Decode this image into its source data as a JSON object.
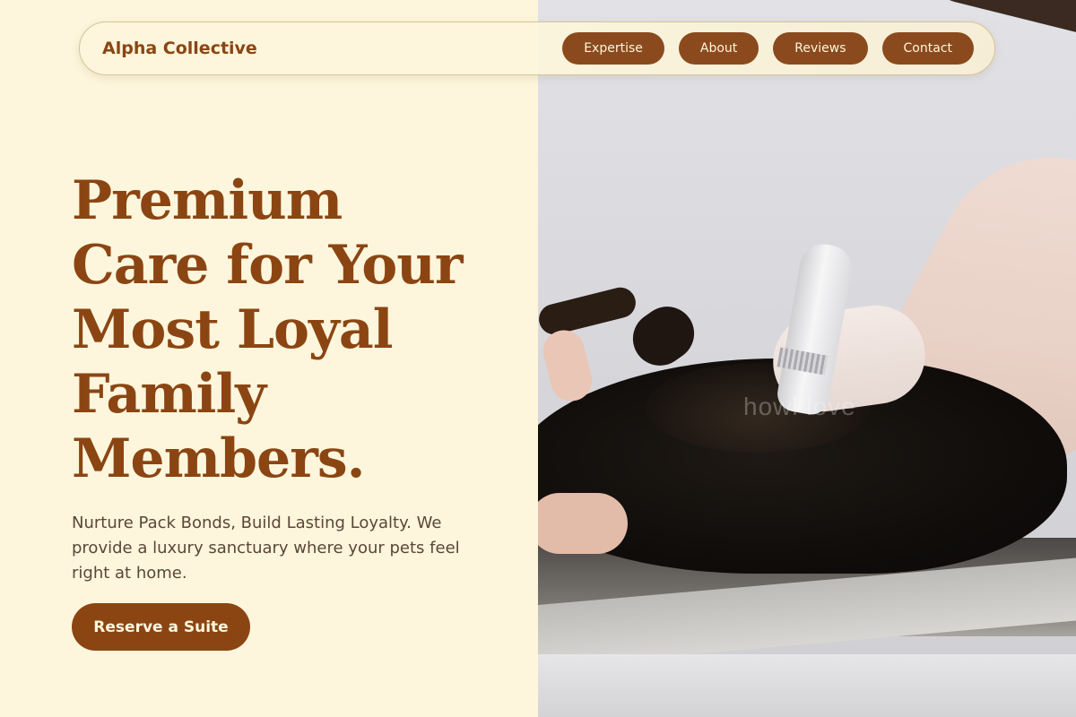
{
  "brand": {
    "name": "Alpha Collective"
  },
  "nav": {
    "items": [
      {
        "label": "Expertise"
      },
      {
        "label": "About"
      },
      {
        "label": "Reviews"
      },
      {
        "label": "Contact"
      }
    ]
  },
  "hero": {
    "title": "Premium Care for Your Most Loyal Family Members.",
    "subtitle": "Nurture Pack Bonds, Build Lasting Loyalty. We provide a luxury sanctuary where your pets feel right at home.",
    "cta_label": "Reserve a Suite"
  },
  "photo": {
    "watermark": "howl love"
  },
  "colors": {
    "brand_brown": "#8b4513",
    "cream_background": "#fdf6dc",
    "body_text": "#5b4638"
  }
}
